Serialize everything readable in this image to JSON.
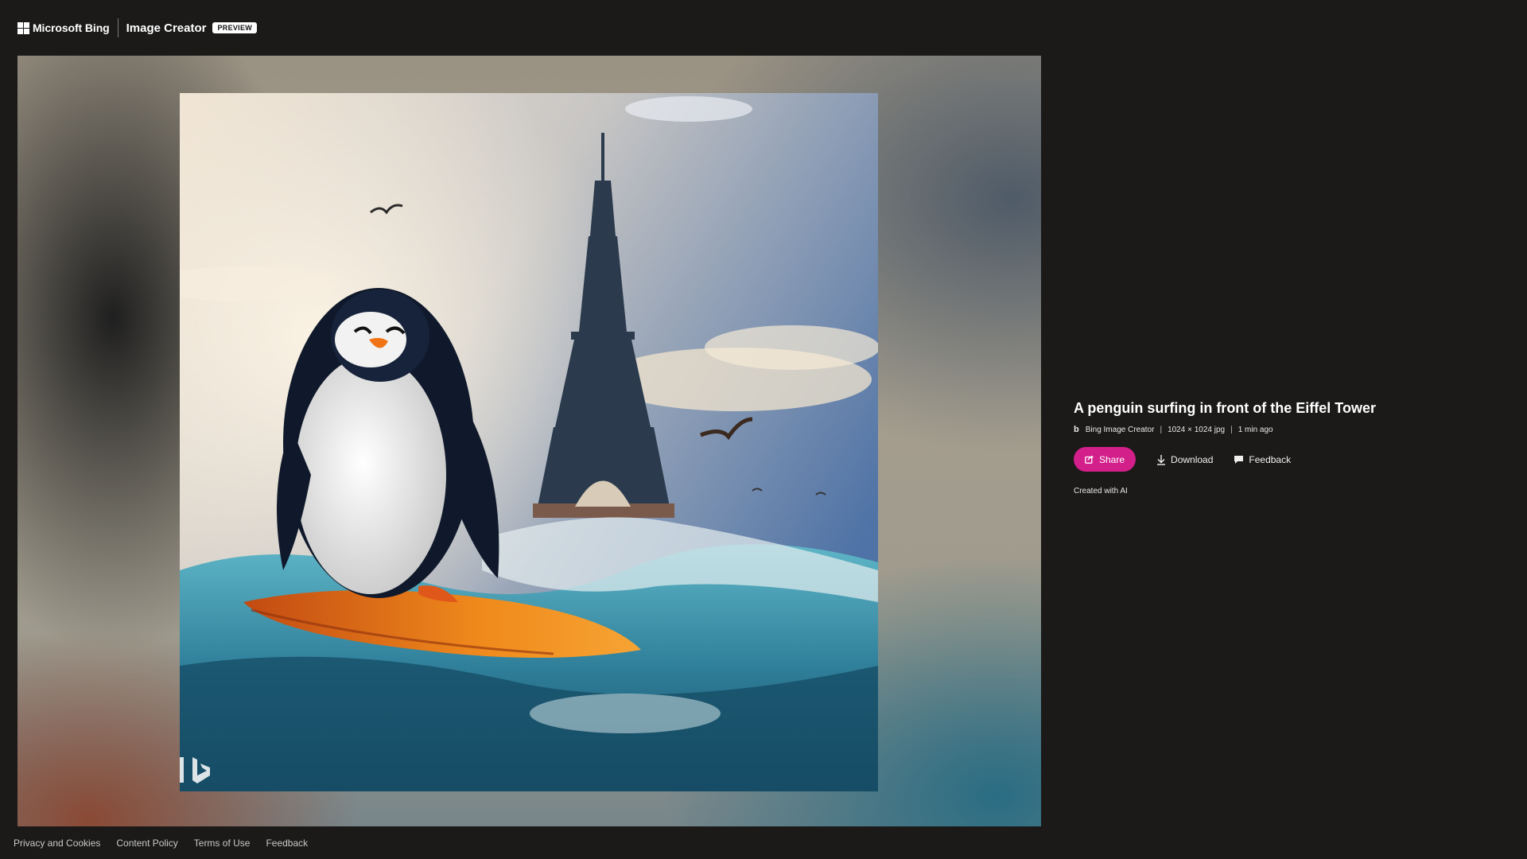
{
  "header": {
    "brand": "Microsoft Bing",
    "product": "Image Creator",
    "badge": "PREVIEW"
  },
  "image": {
    "alt": "A penguin surfing in front of the Eiffel Tower",
    "watermark_icon": "bing-logo-icon"
  },
  "info": {
    "title": "A penguin surfing in front of the Eiffel Tower",
    "source_icon": "bing-logo-icon",
    "source": "Bing Image Creator",
    "dimensions": "1024 × 1024 jpg",
    "time": "1 min ago",
    "share_label": "Share",
    "download_label": "Download",
    "feedback_label": "Feedback",
    "ai_note": "Created with AI"
  },
  "footer": {
    "links": [
      "Privacy and Cookies",
      "Content Policy",
      "Terms of Use",
      "Feedback"
    ]
  },
  "colors": {
    "share_button": "#d21f8a",
    "background": "#1b1a19"
  }
}
